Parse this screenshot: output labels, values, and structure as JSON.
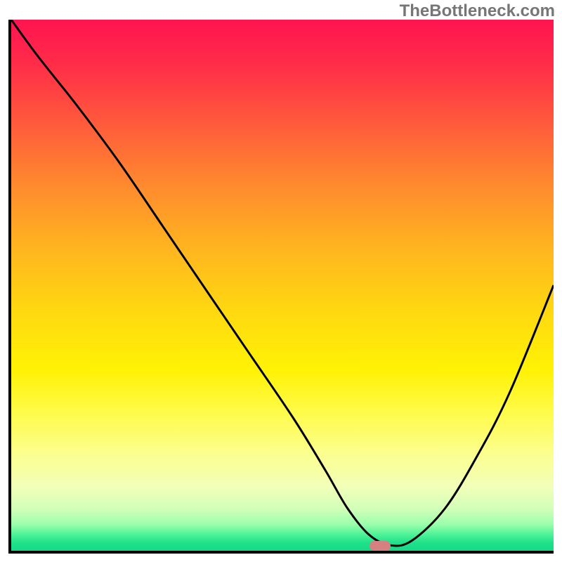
{
  "watermark": "TheBottleneck.com",
  "chart_data": {
    "type": "line",
    "title": "",
    "xlabel": "",
    "ylabel": "",
    "xlim": [
      0,
      100
    ],
    "ylim": [
      0,
      100
    ],
    "x": [
      0,
      5,
      12,
      20,
      28,
      36,
      44,
      52,
      58,
      62,
      66,
      70,
      74,
      80,
      86,
      92,
      100
    ],
    "y": [
      100,
      93,
      84,
      73,
      61,
      49,
      37,
      25,
      15,
      8,
      3,
      1,
      2,
      8,
      18,
      30,
      50
    ],
    "minimum_marker": {
      "x": 68,
      "y": 0.5
    },
    "curve_note": "V-shaped bottleneck curve; minimum near x≈68",
    "gradient_note": "vertical heat gradient red→yellow→green (bad→good)"
  },
  "colors": {
    "axis": "#000000",
    "curve": "#000000",
    "marker": "#d68081",
    "watermark_text": "#777677"
  }
}
